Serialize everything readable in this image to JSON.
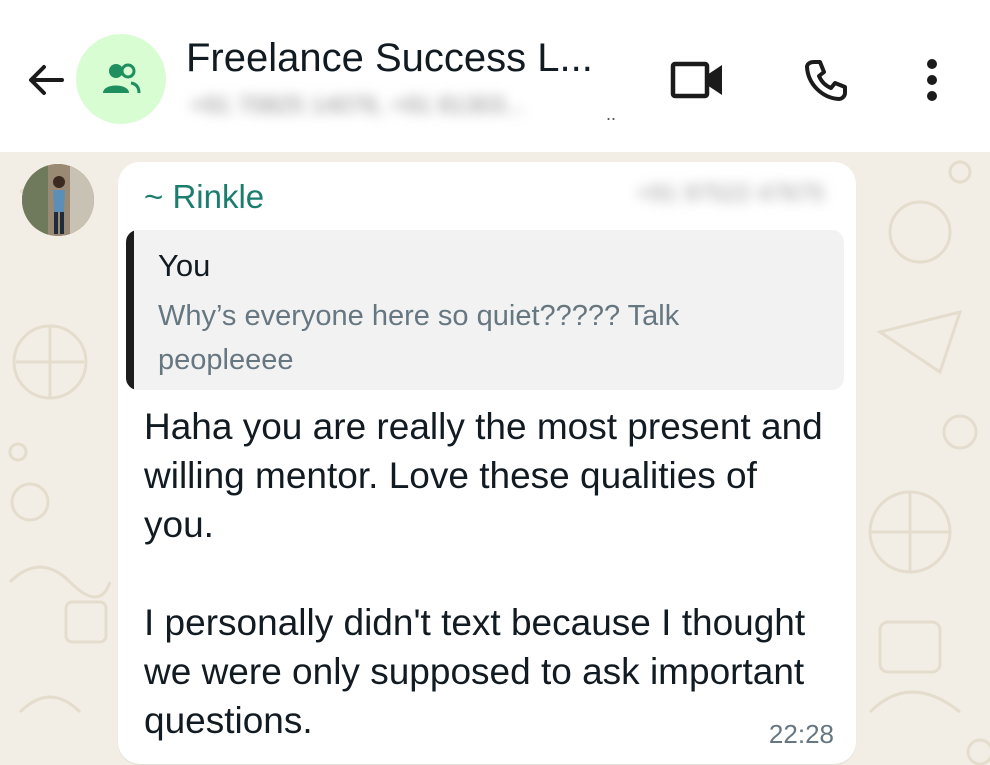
{
  "header": {
    "title": "Freelance Success L...",
    "subtitle": "+91 70825 14076, +91 81303...",
    "subtitle_dots": "..",
    "icons": {
      "back": "back-arrow-icon",
      "avatar": "group-icon",
      "video": "video-call-icon",
      "call": "phone-icon",
      "menu": "more-vertical-icon"
    }
  },
  "message": {
    "sender_name": "~ Rinkle",
    "sender_phone": "+91 97522 47675",
    "quote": {
      "author": "You",
      "text": "Why’s everyone here so quiet????? Talk peopleeee"
    },
    "paragraph_1": "Haha you are really the most present and willing mentor. Love these qualities of you.",
    "paragraph_2": "I personally didn't text because I thought we were only supposed to ask important questions.",
    "time": "22:28"
  },
  "colors": {
    "accent_green": "#1a7d6e",
    "avatar_bg": "#d9fdd3",
    "chat_bg": "#f3eee5",
    "quote_bar": "#1c1c1c"
  }
}
